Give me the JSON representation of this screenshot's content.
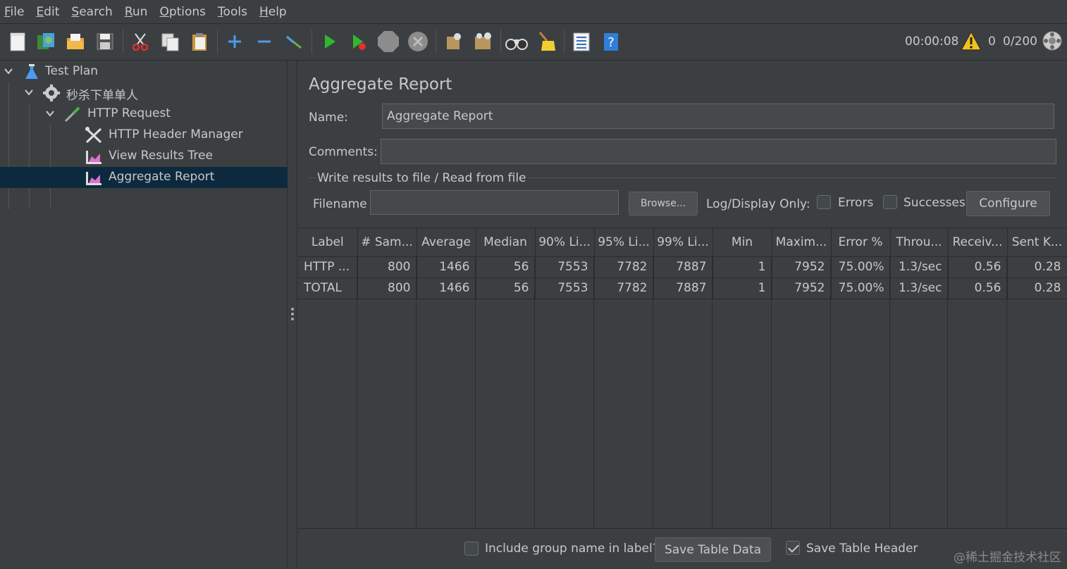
{
  "menu": [
    {
      "mnemonic": "F",
      "rest": "ile"
    },
    {
      "mnemonic": "E",
      "rest": "dit"
    },
    {
      "mnemonic": "S",
      "rest": "earch"
    },
    {
      "mnemonic": "R",
      "rest": "un"
    },
    {
      "mnemonic": "O",
      "rest": "ptions"
    },
    {
      "mnemonic": "T",
      "rest": "ools"
    },
    {
      "mnemonic": "H",
      "rest": "elp"
    }
  ],
  "toolbar": {
    "icons": [
      "new-icon",
      "templates-icon",
      "open-icon",
      "save-icon",
      "cut-icon",
      "copy-icon",
      "paste-icon",
      "expand-icon",
      "collapse-icon",
      "toggle-icon",
      "start-icon",
      "start-no-pause-icon",
      "stop-icon",
      "shutdown-icon",
      "clear-icon",
      "clear-all-icon",
      "search-icon",
      "reset-search-icon",
      "function-helper-icon",
      "help-icon"
    ],
    "elapsed_time": "00:00:08",
    "error_count": "0",
    "active_threads": "0/200"
  },
  "tree": {
    "items": [
      {
        "label": "Test Plan",
        "icon": "test-plan-icon"
      },
      {
        "label": "秒杀下单单人",
        "icon": "thread-group-icon"
      },
      {
        "label": "HTTP Request",
        "icon": "sampler-icon"
      },
      {
        "label": "HTTP Header Manager",
        "icon": "config-element-icon"
      },
      {
        "label": "View Results Tree",
        "icon": "listener-icon"
      },
      {
        "label": "Aggregate Report",
        "icon": "listener-icon"
      }
    ],
    "selected_index": 5
  },
  "panel": {
    "title": "Aggregate Report",
    "name_label": "Name:",
    "name_value": "Aggregate Report",
    "comments_label": "Comments:",
    "comments_value": "",
    "file_group_title": "Write results to file / Read from file",
    "filename_label": "Filename",
    "filename_value": "",
    "browse_label": "Browse...",
    "log_display_label": "Log/Display Only:",
    "errors_label": "Errors",
    "errors_checked": false,
    "successes_label": "Successes",
    "successes_checked": false,
    "configure_label": "Configure"
  },
  "table": {
    "columns": [
      "Label",
      "# Sam...",
      "Average",
      "Median",
      "90% Li...",
      "95% Li...",
      "99% Li...",
      "Min",
      "Maxim...",
      "Error %",
      "Throu...",
      "Receiv...",
      "Sent K..."
    ],
    "rows": [
      [
        "HTTP ...",
        "800",
        "1466",
        "56",
        "7553",
        "7782",
        "7887",
        "1",
        "7952",
        "75.00%",
        "1.3/sec",
        "0.56",
        "0.28"
      ],
      [
        "TOTAL",
        "800",
        "1466",
        "56",
        "7553",
        "7782",
        "7887",
        "1",
        "7952",
        "75.00%",
        "1.3/sec",
        "0.56",
        "0.28"
      ]
    ]
  },
  "footer": {
    "include_group_label": "Include group name in label?",
    "include_group_checked": false,
    "save_table_data_label": "Save Table Data",
    "save_table_header_label": "Save Table Header",
    "save_table_header_checked": true
  },
  "watermark": "@稀土掘金技术社区"
}
